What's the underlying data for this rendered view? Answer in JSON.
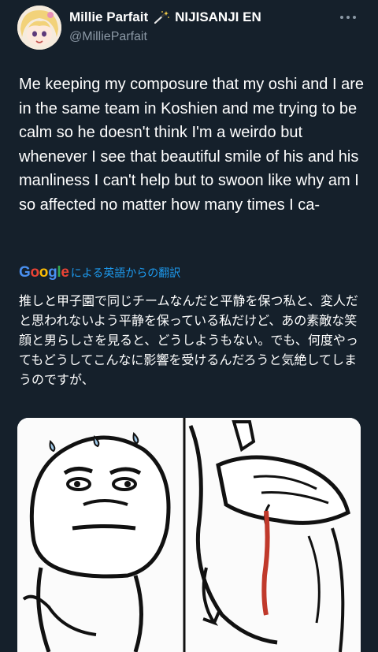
{
  "user": {
    "display_name": "Millie Parfait",
    "affiliation": "NIJISANJI EN",
    "handle": "@MillieParfait"
  },
  "tweet": {
    "text": "Me keeping my composure that my oshi and I are in the same team in Koshien and me trying to be calm so he doesn't think I'm a weirdo but whenever I see that beautiful smile of his and his manliness I can't help but to swoon like why am I so affected no matter how many times I ca-"
  },
  "translation": {
    "provider": "Google",
    "label": "による英語からの翻訳",
    "text": "推しと甲子園で同じチームなんだと平静を保つ私と、変人だと思われないよう平静を保っている私だけど、あの素敵な笑顔と男らしさを見ると、どうしようもない。でも、何度やってもどうしてこんなに影響を受けるんだろうと気絶してしまうのですが、"
  },
  "icons": {
    "wand": "magic-wand-icon",
    "more": "more-options-icon"
  },
  "colors": {
    "background": "#15202b",
    "text": "#ffffff",
    "secondary": "#8b98a5",
    "link": "#1d9bf0"
  }
}
